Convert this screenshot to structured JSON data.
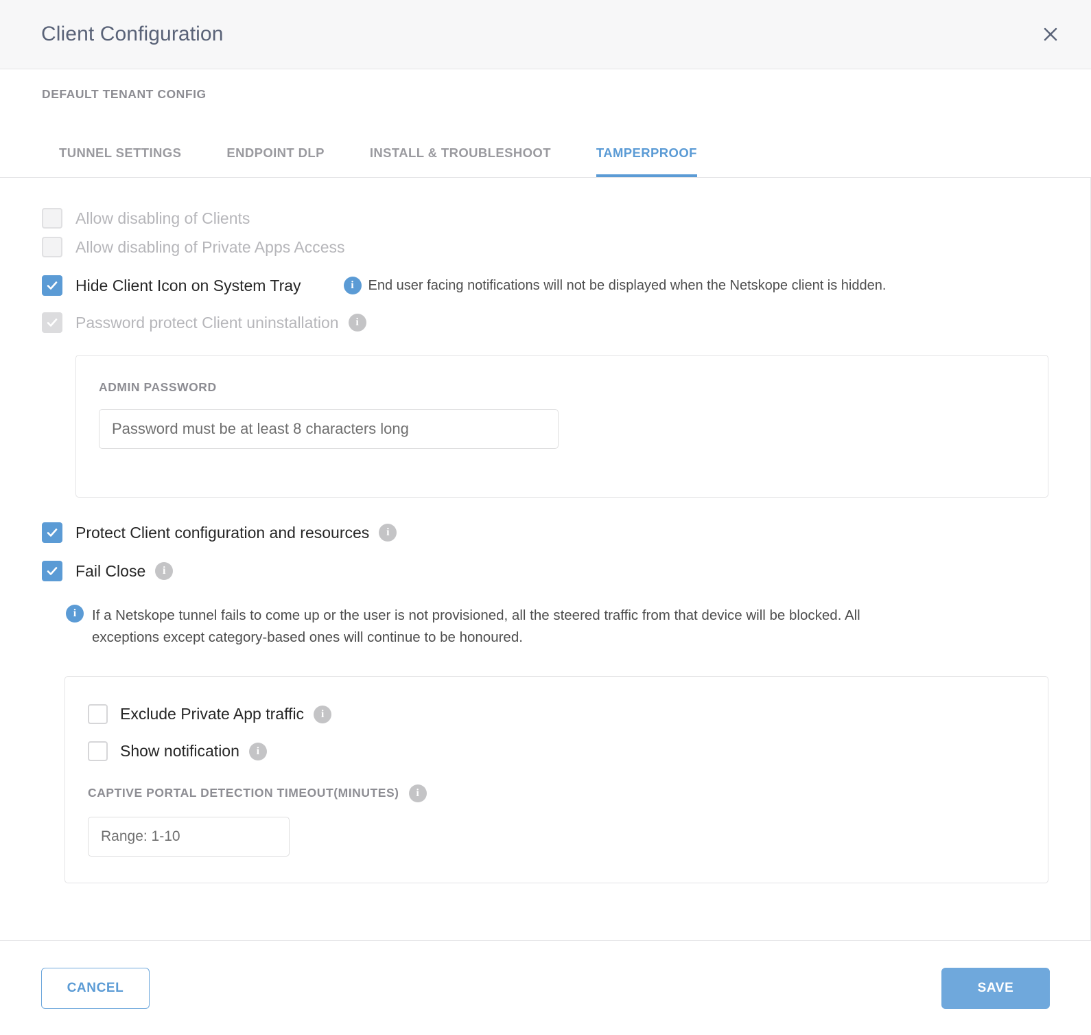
{
  "dialog": {
    "title": "Client Configuration",
    "close_icon": "close-icon",
    "subtitle": "DEFAULT TENANT CONFIG"
  },
  "tabs": [
    {
      "label": "TUNNEL SETTINGS",
      "active": false
    },
    {
      "label": "ENDPOINT DLP",
      "active": false
    },
    {
      "label": "INSTALL & TROUBLESHOOT",
      "active": false
    },
    {
      "label": "TAMPERPROOF",
      "active": true
    }
  ],
  "options": {
    "allow_disabling_clients": "Allow disabling of Clients",
    "allow_disabling_private_apps": "Allow disabling of Private Apps Access",
    "hide_client_icon": "Hide Client Icon on System Tray",
    "hide_client_icon_note": "End user facing notifications will not be displayed when the Netskope client is hidden.",
    "password_protect": "Password protect Client uninstallation",
    "protect_client_config": "Protect Client configuration and resources",
    "fail_close": "Fail Close",
    "fail_close_desc": "If a Netskope tunnel fails to come up or the user is not provisioned, all the steered traffic from that device will be blocked. All exceptions except category-based ones will continue to be honoured."
  },
  "admin_password": {
    "label": "ADMIN PASSWORD",
    "placeholder": "Password must be at least 8 characters long",
    "value": ""
  },
  "fail_close_panel": {
    "exclude_private_app": "Exclude Private App traffic",
    "show_notification": "Show notification",
    "captive_label": "CAPTIVE PORTAL DETECTION TIMEOUT(MINUTES)",
    "captive_placeholder": "Range: 1-10",
    "captive_value": ""
  },
  "footer": {
    "cancel_label": "CANCEL",
    "save_label": "SAVE"
  },
  "colors": {
    "accent": "#5b9bd5",
    "button": "#6fa8dc",
    "title": "#5a6378",
    "muted": "#8d8d93",
    "disabled": "#b6b6ba",
    "info_grey": "#c4c4c6"
  }
}
